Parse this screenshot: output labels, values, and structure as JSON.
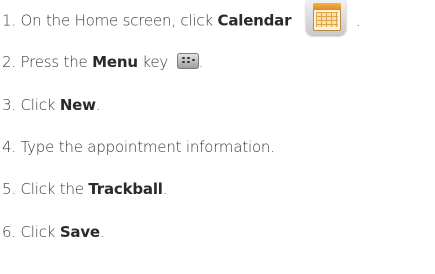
{
  "steps": [
    {
      "num": "1.",
      "pre": "On the Home screen, click ",
      "bold": "Calendar",
      "post": "."
    },
    {
      "num": "2.",
      "pre": "Press the ",
      "bold": "Menu",
      "mid": " key ",
      "post": "."
    },
    {
      "num": "3.",
      "pre": "Click ",
      "bold": "New",
      "post": "."
    },
    {
      "num": "4.",
      "pre": "Type the appointment information."
    },
    {
      "num": "5.",
      "pre": "Click the ",
      "bold": "Trackball",
      "post": "."
    },
    {
      "num": "6.",
      "pre": "Click ",
      "bold": "Save",
      "post": "."
    }
  ],
  "icons": {
    "calendar": "calendar-icon",
    "menu_key": "menu-key-icon"
  },
  "colors": {
    "text": "#3a3a3a",
    "calendar_accent": "#f7b24a"
  }
}
